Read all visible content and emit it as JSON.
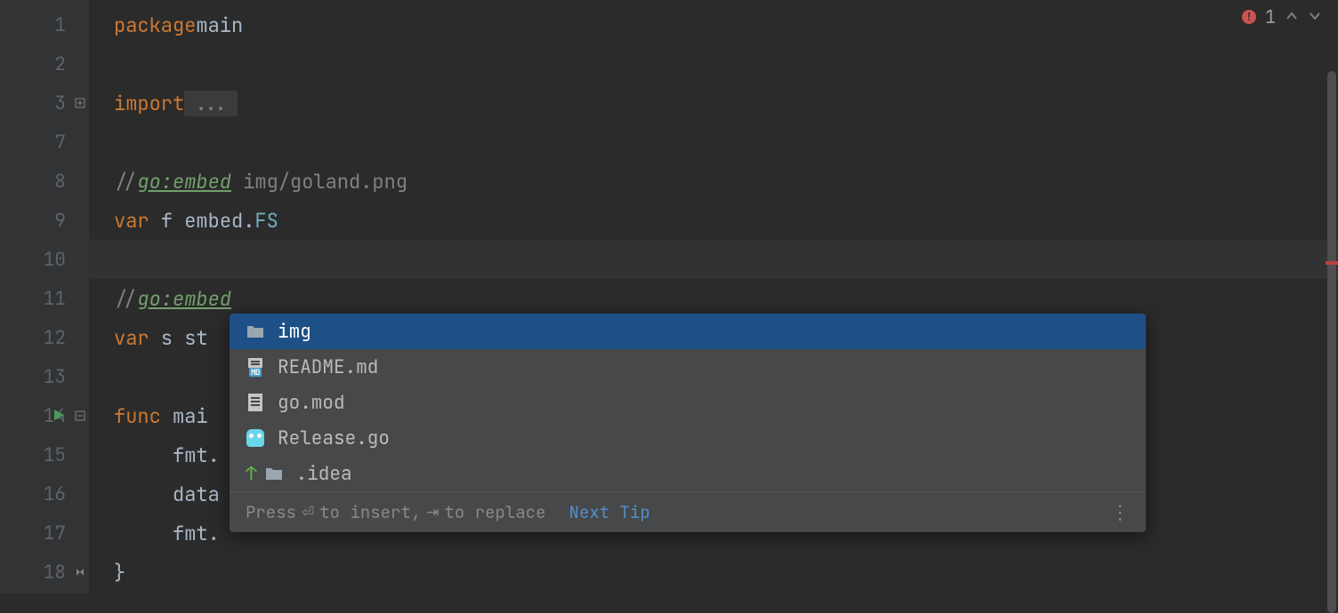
{
  "gutter_lines": [
    "1",
    "2",
    "3",
    "7",
    "8",
    "9",
    "10",
    "11",
    "12",
    "13",
    "14",
    "15",
    "16",
    "17",
    "18"
  ],
  "code": {
    "l1": {
      "kw": "package",
      "name": "main"
    },
    "l3": {
      "kw": "import",
      "folded": "..."
    },
    "l8": {
      "slashes": "//",
      "directive": "go:embed",
      "path": " img/goland.png"
    },
    "l9": {
      "kw": "var",
      "name": " f ",
      "pkg": "embed.",
      "type": "FS"
    },
    "l11": {
      "slashes": "//",
      "directive": "go:embed"
    },
    "l12": {
      "kw": "var",
      "name": " s ",
      "type_partial": "st"
    },
    "l14": {
      "kw": "func",
      "name": " mai"
    },
    "l15": {
      "indent": "     ",
      "text": "fmt."
    },
    "l16": {
      "indent": "     ",
      "text": "data"
    },
    "l17": {
      "indent": "     ",
      "text": "fmt."
    },
    "l18": {
      "text": "}"
    }
  },
  "inspection": {
    "error_count": "1"
  },
  "popup": {
    "items": [
      {
        "icon": "folder",
        "label": "img",
        "selected": true
      },
      {
        "icon": "md",
        "label": "README.md"
      },
      {
        "icon": "file",
        "label": "go.mod"
      },
      {
        "icon": "gopher",
        "label": "Release.go"
      },
      {
        "icon": "folder",
        "label": ".idea",
        "up": true
      }
    ],
    "footer": {
      "press": "Press",
      "enter_hint": "to insert,",
      "tab_hint": "to replace",
      "next_tip": "Next Tip"
    }
  }
}
